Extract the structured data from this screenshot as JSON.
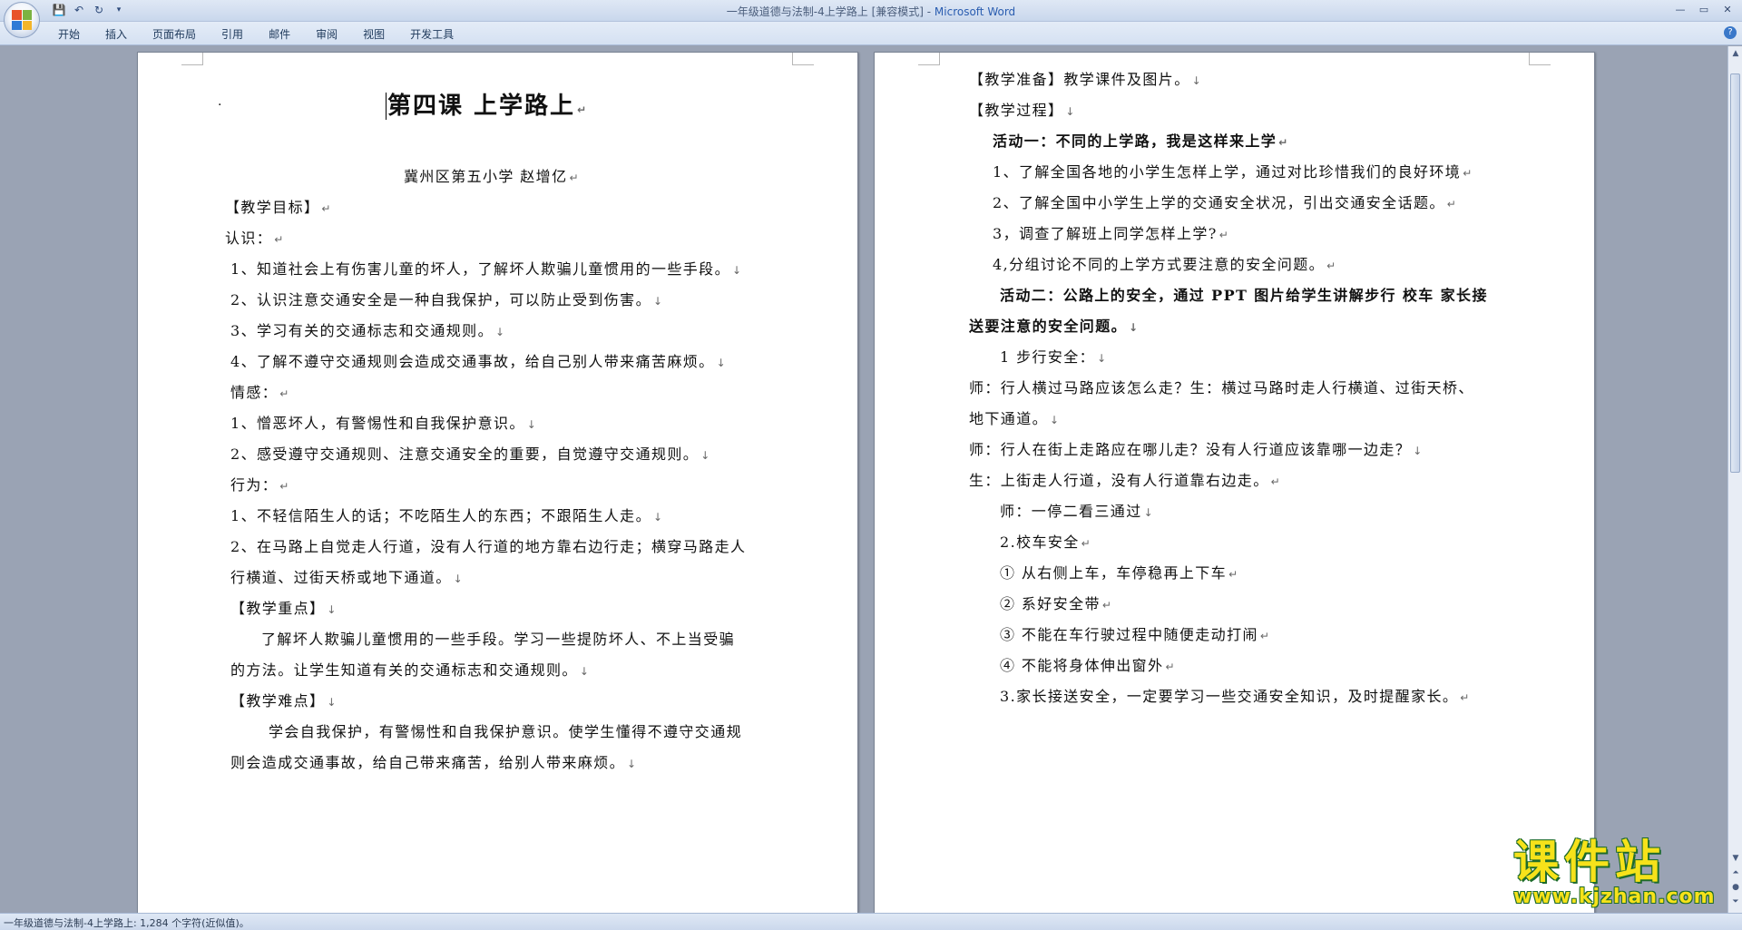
{
  "window": {
    "title_doc": "一年级道德与法制-4上学路上 [兼容模式] - ",
    "title_app": "Microsoft Word",
    "controls": [
      "—",
      "▭",
      "✕"
    ]
  },
  "ribbon": {
    "tabs": [
      "开始",
      "插入",
      "页面布局",
      "引用",
      "邮件",
      "审阅",
      "视图",
      "开发工具"
    ],
    "help": "?"
  },
  "qat": {
    "save": "💾",
    "undo": "↶",
    "redo": "↻",
    "more": "▾"
  },
  "left_page": {
    "title": "第四课   上学路上",
    "author": "冀州区第五小学  赵增亿",
    "lines": [
      "【教学目标】",
      "认识：",
      "1、知道社会上有伤害儿童的坏人，了解坏人欺骗儿童惯用的一些手段。",
      "2、认识注意交通安全是一种自我保护，可以防止受到伤害。",
      "3、学习有关的交通标志和交通规则。",
      "4、了解不遵守交通规则会造成交通事故，给自己别人带来痛苦麻烦。",
      "情感：",
      "1、憎恶坏人，有警惕性和自我保护意识。",
      "2、感受遵守交通规则、注意交通安全的重要，自觉遵守交通规则。",
      "行为：",
      "1、不轻信陌生人的话；不吃陌生人的东西；不跟陌生人走。",
      "2、在马路上自觉走人行道，没有人行道的地方靠右边行走；横穿马路走人",
      "行横道、过街天桥或地下通道。",
      "【教学重点】",
      "了解坏人欺骗儿童惯用的一些手段。学习一些提防坏人、不上当受骗",
      "的方法。让学生知道有关的交通标志和交通规则。",
      "【教学难点】",
      "学会自我保护，有警惕性和自我保护意识。使学生懂得不遵守交通规",
      "则会造成交通事故，给自己带来痛苦，给别人带来麻烦。"
    ]
  },
  "right_page": {
    "lines": [
      "【教学准备】教学课件及图片。",
      "【教学过程】",
      "活动一：不同的上学路，我是这样来上学",
      "1、了解全国各地的小学生怎样上学，通过对比珍惜我们的良好环境",
      "2、了解全国中小学生上学的交通安全状况，引出交通安全话题。",
      "3，调查了解班上同学怎样上学?",
      "4,分组讨论不同的上学方式要注意的安全问题。",
      "活动二：公路上的安全，通过 PPT 图片给学生讲解步行  校车  家长接",
      "送要注意的安全问题。",
      "1 步行安全：",
      "师：行人横过马路应该怎么走？生：横过马路时走人行横道、过街天桥、",
      "地下通道。",
      "师：行人在街上走路应在哪儿走？没有人行道应该靠哪一边走？",
      "生：上街走人行道，没有人行道靠右边走。",
      "师：一停二看三通过",
      "2.校车安全",
      "①    从右侧上车，车停稳再上下车",
      "②    系好安全带",
      "③    不能在车行驶过程中随便走动打闹",
      "④    不能将身体伸出窗外",
      "3.家长接送安全，一定要学习一些交通安全知识，及时提醒家长。"
    ]
  },
  "statusbar": {
    "text": "一年级道德与法制-4上学路上: 1,284 个字符(近似值)。"
  },
  "watermark": {
    "main": "课件站",
    "url": "www.kjzhan.com"
  }
}
